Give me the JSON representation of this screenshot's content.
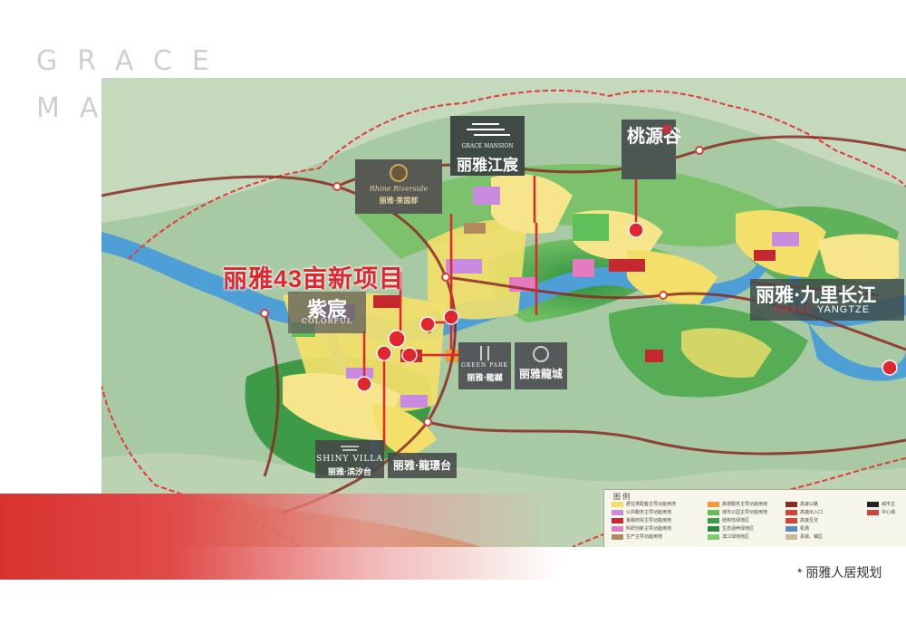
{
  "brand": {
    "line1": "GRACE",
    "line2": "MANSION"
  },
  "headline": "丽雅43亩新项目",
  "projects": {
    "hongchen": {
      "en": "GRACE MANSION",
      "cn": "丽雅江宸"
    },
    "taoyuan": {
      "cn": "桃源谷"
    },
    "rhine": {
      "en": "Rhine Riverside",
      "cn": "丽雅·莱茵郡"
    },
    "yangtze": {
      "cn": "丽雅·九里长江",
      "en_accent": "GRACE",
      "en_rest": " YANGTZE"
    },
    "colorful": {
      "cn": "紫宸",
      "en": "COLORFUL"
    },
    "greenpark": {
      "en": "GREEN PARK",
      "cn": "丽雅·龍樾"
    },
    "longcheng": {
      "cn": "丽雅龍城"
    },
    "shiny": {
      "en": "SHINY VILLA",
      "cn": "丽雅·滨汐台"
    },
    "jingtai": {
      "cn": "丽雅·龍璟台"
    }
  },
  "legend": {
    "title": "图 例",
    "items": [
      {
        "label": "居住类配套主导功能用地",
        "color": "#f3df6a"
      },
      {
        "label": "公共服务主导功能用地",
        "color": "#c98be0"
      },
      {
        "label": "金融商贸主导功能用地",
        "color": "#c5282e"
      },
      {
        "label": "科研创新主导功能用地",
        "color": "#e47bc0"
      },
      {
        "label": "生产主导功能用地",
        "color": "#b08a5e"
      },
      {
        "label": "旅游服务主导功能用地",
        "color": "#f29a3a"
      },
      {
        "label": "城市公园主导功能用地",
        "color": "#5fbf5a"
      },
      {
        "label": "结构性绿地区",
        "color": "#3f9b4a"
      },
      {
        "label": "生态涵养绿地区",
        "color": "#2f8840"
      },
      {
        "label": "滨江绿地地区",
        "color": "#7ccf6a"
      },
      {
        "label": "高速公路",
        "color": "#8b2a22"
      },
      {
        "label": "高速出入口",
        "color": "#d7423b"
      },
      {
        "label": "高速互交",
        "color": "#d7423b"
      },
      {
        "label": "机场",
        "color": "#5a8ac8"
      },
      {
        "label": "县城、镇区",
        "color": "#c9b99a"
      },
      {
        "label": "城市主",
        "color": "#222222"
      },
      {
        "label": "中心城",
        "color": "#d7423b"
      }
    ]
  },
  "caption": "* 丽雅人居规划",
  "colors": {
    "accent": "#e1262f",
    "band": "#d8322f",
    "river": "#4d9fd6",
    "panel": "#3f4a46"
  }
}
